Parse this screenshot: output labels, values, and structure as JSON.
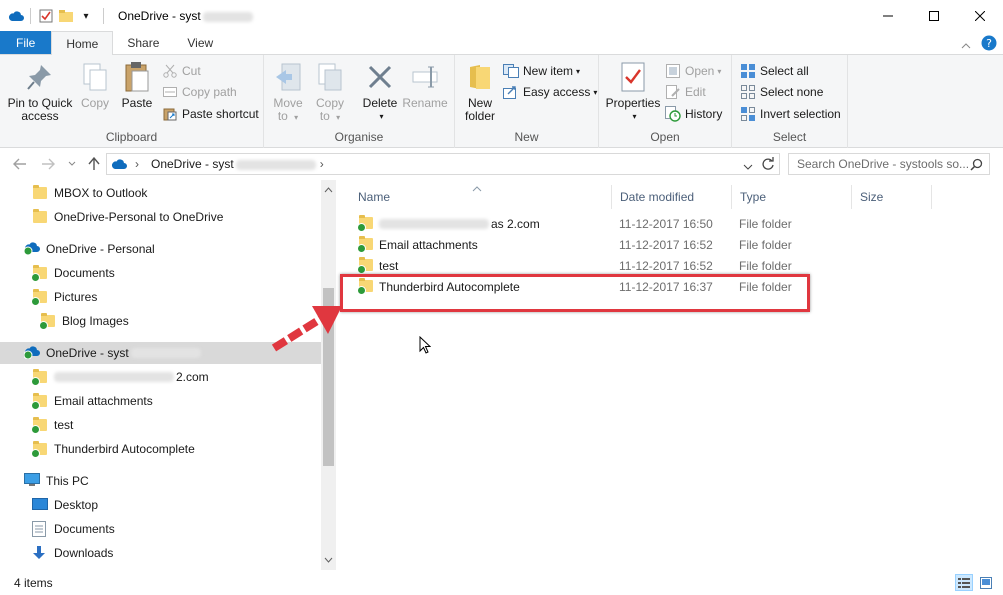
{
  "window": {
    "title": "OneDrive - syst",
    "qat_dropdown": "▾"
  },
  "ribbon_tabs": [
    "File",
    "Home",
    "Share",
    "View"
  ],
  "ribbon": {
    "clipboard": {
      "label": "Clipboard",
      "pin_to_quick_access": [
        "Pin to Quick",
        "access"
      ],
      "copy": "Copy",
      "paste": "Paste",
      "cut": "Cut",
      "copy_path": "Copy path",
      "paste_shortcut": "Paste shortcut"
    },
    "organise": {
      "label": "Organise",
      "move_to": [
        "Move",
        "to"
      ],
      "copy_to": [
        "Copy",
        "to"
      ],
      "delete": "Delete",
      "rename": "Rename"
    },
    "new": {
      "label": "New",
      "new_folder": [
        "New",
        "folder"
      ],
      "new_item": "New item",
      "easy_access": "Easy access"
    },
    "open": {
      "label": "Open",
      "properties": "Properties",
      "open": "Open",
      "edit": "Edit",
      "history": "History"
    },
    "select": {
      "label": "Select",
      "select_all": "Select all",
      "select_none": "Select none",
      "invert_selection": "Invert selection"
    }
  },
  "address": {
    "crumb": "OneDrive - syst",
    "separator": "›"
  },
  "search": {
    "placeholder": "Search OneDrive - systools so..."
  },
  "nav_tree": [
    {
      "label": "MBOX to Outlook"
    },
    {
      "label": "OneDrive-Personal to OneDrive"
    },
    {
      "label": "OneDrive - Personal"
    },
    {
      "label": "Documents"
    },
    {
      "label": "Pictures"
    },
    {
      "label": "Blog Images"
    },
    {
      "label": "OneDrive - syst"
    },
    {
      "label": "2.com"
    },
    {
      "label": "Email attachments"
    },
    {
      "label": "test"
    },
    {
      "label": "Thunderbird Autocomplete"
    },
    {
      "label": "This PC"
    },
    {
      "label": "Desktop"
    },
    {
      "label": "Documents"
    },
    {
      "label": "Downloads"
    }
  ],
  "columns": [
    "Name",
    "Date modified",
    "Type",
    "Size"
  ],
  "files": [
    {
      "name": "as 2.com",
      "date": "11-12-2017 16:50",
      "type": "File folder"
    },
    {
      "name": "Email attachments",
      "date": "11-12-2017 16:52",
      "type": "File folder"
    },
    {
      "name": "test",
      "date": "11-12-2017 16:52",
      "type": "File folder"
    },
    {
      "name": "Thunderbird Autocomplete",
      "date": "11-12-2017 16:37",
      "type": "File folder"
    }
  ],
  "status": {
    "item_count": "4 items"
  },
  "colors": {
    "file_tab": "#1979ca",
    "highlight": "#e0373f",
    "sync_ok": "#2d9a3a",
    "folder": "#f8d775"
  }
}
